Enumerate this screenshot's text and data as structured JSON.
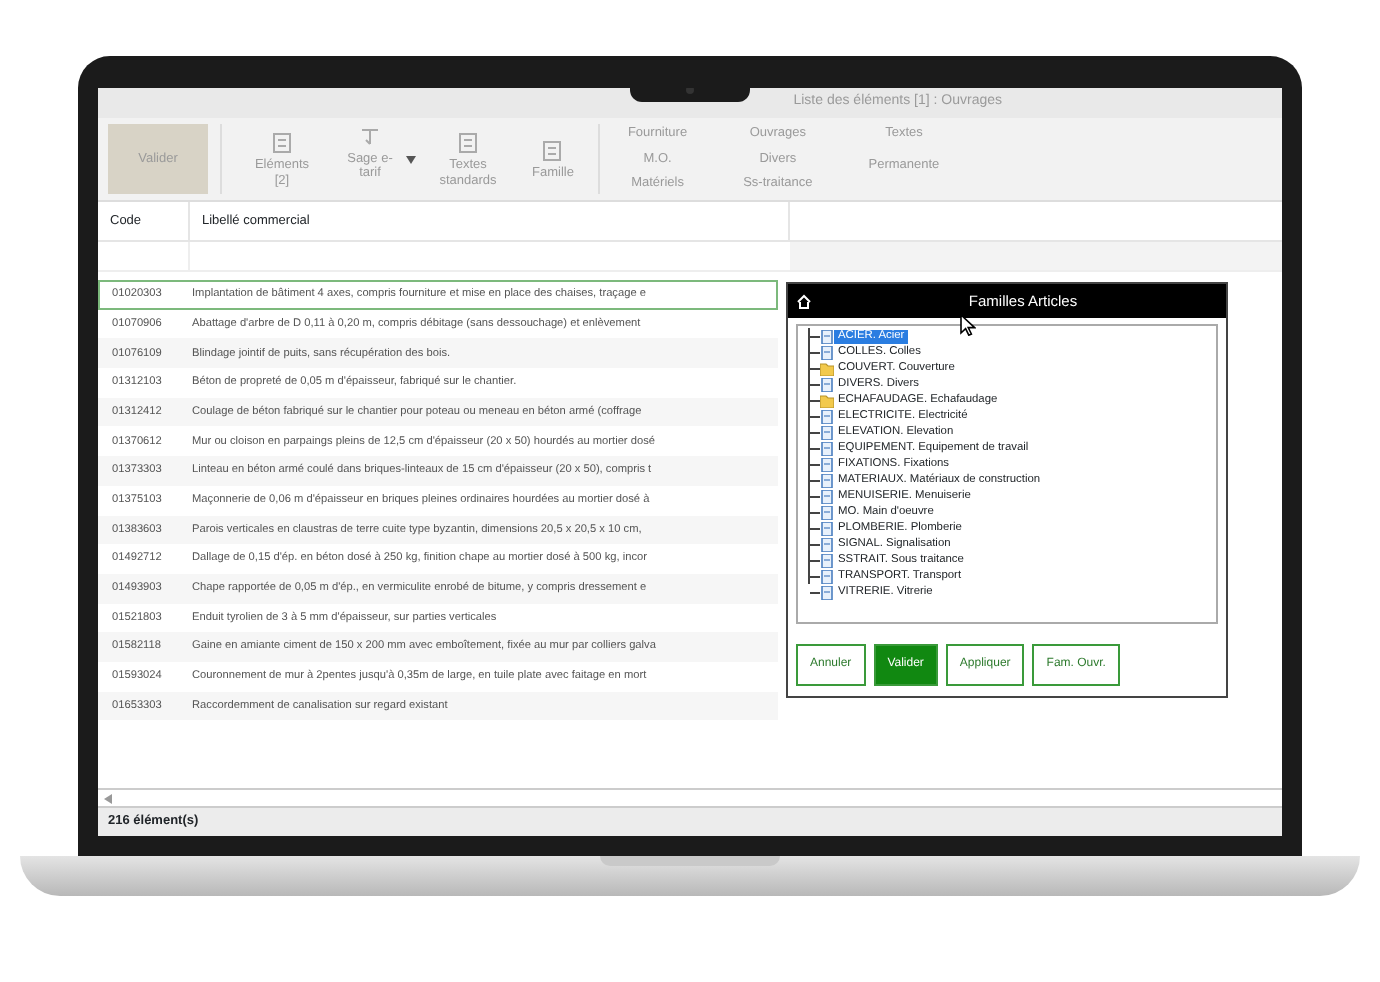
{
  "window": {
    "title": "Liste des éléments [1] : Ouvrages"
  },
  "toolbar": {
    "buttons": [
      {
        "label": "Valider",
        "kind": "big",
        "disabled": true
      },
      {
        "label": "Eléments [2]",
        "kind": "big",
        "disabled": false
      },
      {
        "label": "Sage e-tarif",
        "kind": "dropdown",
        "disabled": false
      },
      {
        "label": "Textes standards",
        "kind": "big",
        "disabled": false
      },
      {
        "label": "Famille",
        "kind": "big",
        "disabled": false
      }
    ],
    "filters": [
      [
        "Fourniture",
        "M.O.",
        "Matériels"
      ],
      [
        "Ouvrages",
        "Divers",
        "Ss-traitance"
      ],
      [
        "Textes",
        "Permanente"
      ]
    ]
  },
  "table": {
    "columns": [
      "Code",
      "Libellé commercial"
    ],
    "rows": [
      {
        "code": "01020303",
        "label": "Implantation de bâtiment 4 axes, compris fourniture et mise en place des chaises, traçage e",
        "selected": true
      },
      {
        "code": "01070906",
        "label": "Abattage d'arbre de D 0,11 à 0,20 m, compris débitage (sans dessouchage) et enlèvement",
        "selected": false
      },
      {
        "code": "01076109",
        "label": "Blindage jointif de puits, sans récupération des bois.",
        "selected": false
      },
      {
        "code": "01312103",
        "label": "Béton de propreté de 0,05 m d'épaisseur, fabriqué sur le chantier.",
        "selected": false
      },
      {
        "code": "01312412",
        "label": "Coulage de béton fabriqué sur le chantier pour poteau ou meneau en béton armé (coffrage",
        "selected": false
      },
      {
        "code": "01370612",
        "label": "Mur ou cloison en parpaings pleins de 12,5 cm d'épaisseur (20 x 50) hourdés au mortier dosé",
        "selected": false
      },
      {
        "code": "01373303",
        "label": "Linteau en béton armé coulé dans briques-linteaux de 15 cm d'épaisseur (20 x 50), compris t",
        "selected": false
      },
      {
        "code": "01375103",
        "label": "Maçonnerie de 0,06 m d'épaisseur en briques pleines ordinaires hourdées au mortier dosé à",
        "selected": false
      },
      {
        "code": "01383603",
        "label": "Parois verticales en claustras de terre cuite type byzantin, dimensions 20,5 x 20,5 x 10 cm,",
        "selected": false
      },
      {
        "code": "01492712",
        "label": "Dallage de 0,15 d'ép. en béton dosé à 250 kg, finition chape au mortier dosé à 500 kg, incor",
        "selected": false
      },
      {
        "code": "01493903",
        "label": "Chape rapportée de 0,05 m d'ép., en vermiculite enrobé de bitume, y compris dressement e",
        "selected": false
      },
      {
        "code": "01521803",
        "label": "Enduit tyrolien de 3 à 5 mm d'épaisseur, sur parties verticales",
        "selected": false
      },
      {
        "code": "01582118",
        "label": "Gaine en amiante ciment de 150 x 200 mm avec emboîtement, fixée au mur par colliers galva",
        "selected": false
      },
      {
        "code": "01593024",
        "label": "Couronnement de mur à 2pentes jusqu'à 0,35m de large, en tuile plate avec faitage en mort",
        "selected": false
      },
      {
        "code": "01653303",
        "label": "Raccordemment de canalisation sur regard existant",
        "selected": false
      }
    ]
  },
  "status_bar": {
    "count": "216 élément(s)"
  },
  "dialog": {
    "title": "Familles Articles",
    "items": [
      {
        "label": "ACIER. Acier",
        "kind": "doc",
        "selected": true
      },
      {
        "label": "COLLES. Colles",
        "kind": "doc",
        "selected": false
      },
      {
        "label": "COUVERT. Couverture",
        "kind": "folder",
        "selected": false
      },
      {
        "label": "DIVERS. Divers",
        "kind": "doc",
        "selected": false
      },
      {
        "label": "ECHAFAUDAGE. Echafaudage",
        "kind": "folder",
        "selected": false
      },
      {
        "label": "ELECTRICITE. Electricité",
        "kind": "doc",
        "selected": false
      },
      {
        "label": "ELEVATION. Elevation",
        "kind": "doc",
        "selected": false
      },
      {
        "label": "EQUIPEMENT. Equipement de travail",
        "kind": "doc",
        "selected": false
      },
      {
        "label": "FIXATIONS. Fixations",
        "kind": "doc",
        "selected": false
      },
      {
        "label": "MATERIAUX. Matériaux de construction",
        "kind": "doc",
        "selected": false
      },
      {
        "label": "MENUISERIE. Menuiserie",
        "kind": "doc",
        "selected": false
      },
      {
        "label": "MO. Main d'oeuvre",
        "kind": "doc",
        "selected": false
      },
      {
        "label": "PLOMBERIE. Plomberie",
        "kind": "doc",
        "selected": false
      },
      {
        "label": "SIGNAL. Signalisation",
        "kind": "doc",
        "selected": false
      },
      {
        "label": "SSTRAIT. Sous traitance",
        "kind": "doc",
        "selected": false
      },
      {
        "label": "TRANSPORT. Transport",
        "kind": "doc",
        "selected": false
      },
      {
        "label": "VITRERIE. Vitrerie",
        "kind": "doc",
        "selected": false
      }
    ],
    "buttons": [
      {
        "label": "Annuler",
        "primary": false
      },
      {
        "label": "Valider",
        "primary": true
      },
      {
        "label": "Appliquer",
        "primary": false
      },
      {
        "label": "Fam. Ouvr.",
        "primary": false
      }
    ]
  }
}
